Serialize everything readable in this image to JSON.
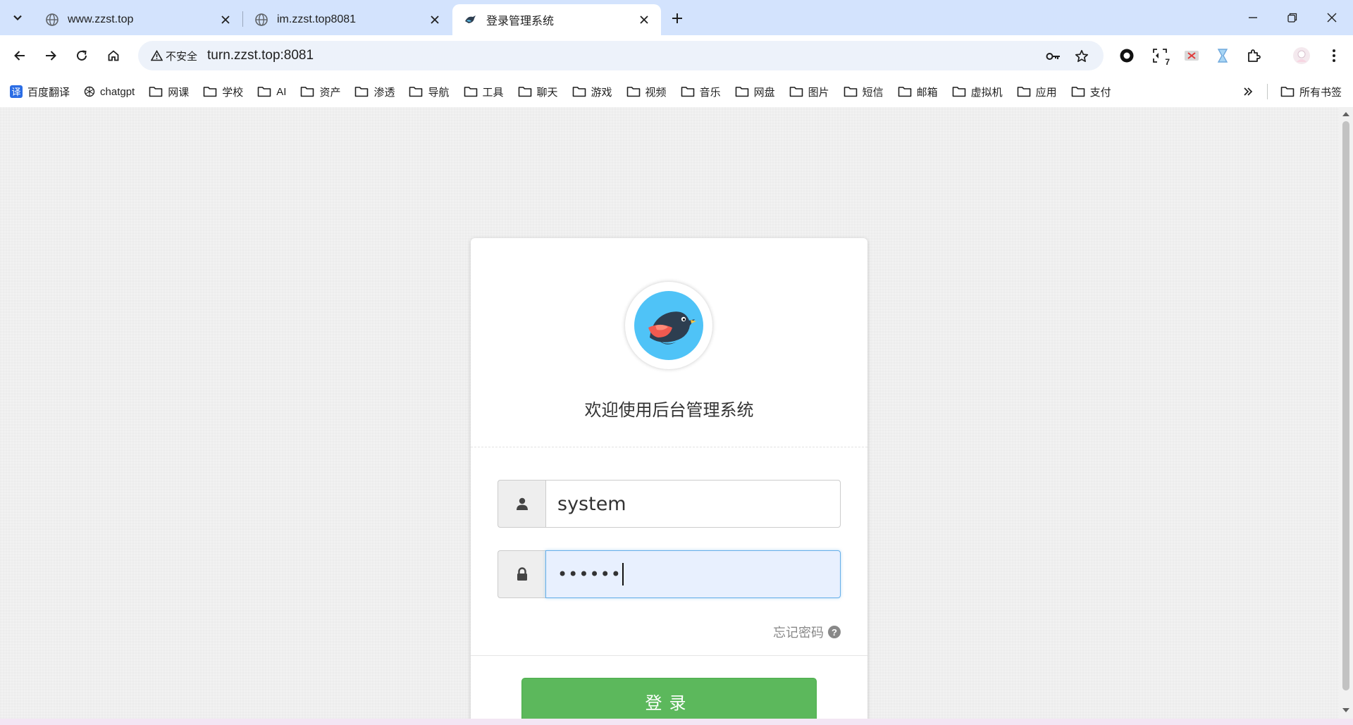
{
  "browser": {
    "tabs": [
      {
        "title": "www.zzst.top",
        "active": false,
        "icon": "globe-icon"
      },
      {
        "title": "im.zzst.top8081",
        "active": false,
        "icon": "globe-icon"
      },
      {
        "title": "登录管理系统",
        "active": true,
        "icon": "bird-icon"
      }
    ],
    "security_label": "不安全",
    "url": "turn.zzst.top:8081",
    "extension_badge": "7",
    "bookmarks": [
      {
        "label": "百度翻译",
        "icon": "translate-icon"
      },
      {
        "label": "chatgpt",
        "icon": "openai-icon"
      },
      {
        "label": "网课",
        "icon": "folder-icon"
      },
      {
        "label": "学校",
        "icon": "folder-icon"
      },
      {
        "label": "AI",
        "icon": "folder-icon"
      },
      {
        "label": "资产",
        "icon": "folder-icon"
      },
      {
        "label": "渗透",
        "icon": "folder-icon"
      },
      {
        "label": "导航",
        "icon": "folder-icon"
      },
      {
        "label": "工具",
        "icon": "folder-icon"
      },
      {
        "label": "聊天",
        "icon": "folder-icon"
      },
      {
        "label": "游戏",
        "icon": "folder-icon"
      },
      {
        "label": "视频",
        "icon": "folder-icon"
      },
      {
        "label": "音乐",
        "icon": "folder-icon"
      },
      {
        "label": "网盘",
        "icon": "folder-icon"
      },
      {
        "label": "图片",
        "icon": "folder-icon"
      },
      {
        "label": "短信",
        "icon": "folder-icon"
      },
      {
        "label": "邮箱",
        "icon": "folder-icon"
      },
      {
        "label": "虚拟机",
        "icon": "folder-icon"
      },
      {
        "label": "应用",
        "icon": "folder-icon"
      },
      {
        "label": "支付",
        "icon": "folder-icon"
      }
    ],
    "all_bookmarks_label": "所有书签"
  },
  "login": {
    "welcome": "欢迎使用后台管理系统",
    "username_value": "system",
    "password_value": "••••••",
    "forgot_label": "忘记密码",
    "submit_label": "登录"
  },
  "colors": {
    "tabbar_bg": "#d3e3fd",
    "omnibox_bg": "#edf2fa",
    "login_button": "#5cb85c",
    "focused_input_bg": "#e8f0fe",
    "avatar_circle": "#4fc3f7"
  }
}
